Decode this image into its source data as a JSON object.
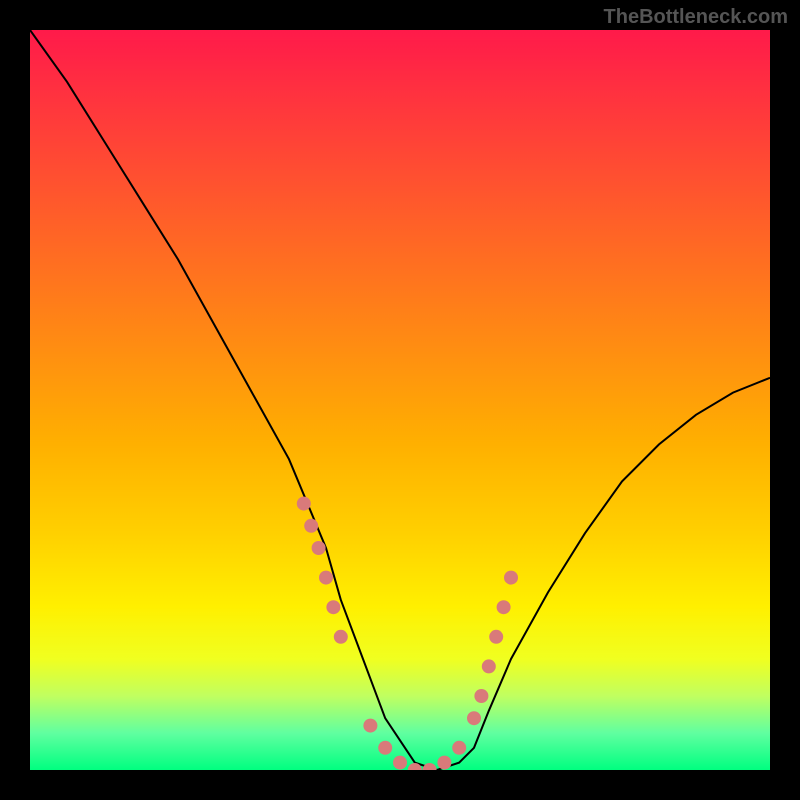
{
  "watermark": "TheBottleneck.com",
  "chart_data": {
    "type": "line",
    "title": "",
    "xlabel": "",
    "ylabel": "",
    "ylim": [
      0,
      100
    ],
    "series": [
      {
        "name": "curve",
        "x": [
          0,
          5,
          10,
          15,
          20,
          25,
          30,
          35,
          40,
          42,
          45,
          48,
          52,
          55,
          58,
          60,
          62,
          65,
          70,
          75,
          80,
          85,
          90,
          95,
          100
        ],
        "values": [
          100,
          93,
          85,
          77,
          69,
          60,
          51,
          42,
          30,
          23,
          15,
          7,
          1,
          0,
          1,
          3,
          8,
          15,
          24,
          32,
          39,
          44,
          48,
          51,
          53
        ]
      }
    ],
    "markers": {
      "color": "#d97a7a",
      "points_x": [
        37,
        38,
        39,
        40,
        41,
        42,
        46,
        48,
        50,
        52,
        54,
        56,
        58,
        60,
        61,
        62,
        63,
        64,
        65
      ],
      "points_y": [
        36,
        33,
        30,
        26,
        22,
        18,
        6,
        3,
        1,
        0,
        0,
        1,
        3,
        7,
        10,
        14,
        18,
        22,
        26
      ]
    }
  }
}
